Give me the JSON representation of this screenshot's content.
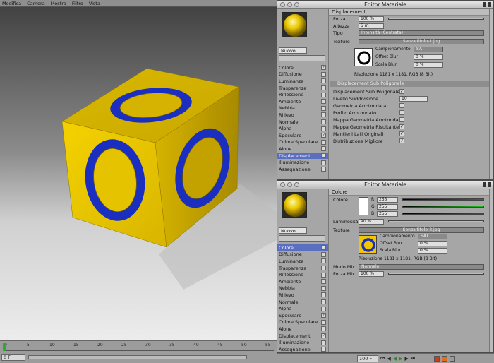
{
  "viewport": {
    "menu": [
      "Modifica",
      "Camera",
      "Mostra",
      "Filtro",
      "Vista"
    ]
  },
  "timeline": {
    "ticks": [
      "0",
      "5",
      "10",
      "15",
      "20",
      "25",
      "30",
      "35",
      "40",
      "45",
      "50",
      "55"
    ],
    "start_field": "0 F",
    "end_field": "100 F"
  },
  "editor1": {
    "title": "Editor Materiale",
    "name": "Nuovo",
    "channels": [
      {
        "label": "Colore",
        "checked": true
      },
      {
        "label": "Diffusione",
        "checked": false
      },
      {
        "label": "Luminanza",
        "checked": false
      },
      {
        "label": "Trasparenza",
        "checked": false
      },
      {
        "label": "Riflessione",
        "checked": false
      },
      {
        "label": "Ambiente",
        "checked": false
      },
      {
        "label": "Nebbia",
        "checked": false
      },
      {
        "label": "Rilievo",
        "checked": false
      },
      {
        "label": "Normale",
        "checked": false
      },
      {
        "label": "Alpha",
        "checked": false
      },
      {
        "label": "Speculare",
        "checked": true
      },
      {
        "label": "Colore Speculare",
        "checked": false
      },
      {
        "label": "Alone",
        "checked": false
      },
      {
        "label": "Displacement",
        "checked": true
      },
      {
        "label": "Illuminazione",
        "checked": false
      },
      {
        "label": "Assegnazione",
        "checked": false
      }
    ],
    "section": "Displacement",
    "forza_label": "Forza",
    "forza_value": "100 %",
    "altezza_label": "Altezza",
    "altezza_value": "5 m",
    "tipo_label": "Tipo",
    "tipo_value": "Intensità (Centrata)",
    "texture_label": "Texture",
    "texture_name": "Senza titolo-1.jpg",
    "campionamento_label": "Campionamento",
    "campionamento_value": "SAT",
    "offset_label": "Offset Blur",
    "offset_value": "0 %",
    "scala_label": "Scala Blur",
    "scala_value": "0 %",
    "risoluzione": "Risoluzione 1181 x 1181, RGB (8 Bit)",
    "subpoly_header": "Displacement Sub Poligonale",
    "subpoly_rows": [
      {
        "label": "Displacement Sub Poligonale",
        "type": "check",
        "checked": true
      },
      {
        "label": "Livello Suddivisione",
        "type": "value",
        "value": "10"
      },
      {
        "label": "Geometria Arrotondata",
        "type": "check",
        "checked": false
      },
      {
        "label": "Profilo Arrotondato",
        "type": "check",
        "checked": false
      },
      {
        "label": "Mappa Geometria Arrotondata",
        "type": "check",
        "checked": false
      },
      {
        "label": "Mappa Geometria Risultante",
        "type": "check",
        "checked": true
      },
      {
        "label": "Mantieni Lati Originali",
        "type": "check",
        "checked": true
      },
      {
        "label": "Distribuzione Migliore",
        "type": "check",
        "checked": true
      }
    ]
  },
  "editor2": {
    "title": "Editor Materiale",
    "name": "Nuovo",
    "channels": [
      {
        "label": "Colore",
        "checked": true
      },
      {
        "label": "Diffusione",
        "checked": false
      },
      {
        "label": "Luminanza",
        "checked": false
      },
      {
        "label": "Trasparenza",
        "checked": false
      },
      {
        "label": "Riflessione",
        "checked": false
      },
      {
        "label": "Ambiente",
        "checked": false
      },
      {
        "label": "Nebbia",
        "checked": false
      },
      {
        "label": "Rilievo",
        "checked": false
      },
      {
        "label": "Normale",
        "checked": false
      },
      {
        "label": "Alpha",
        "checked": false
      },
      {
        "label": "Speculare",
        "checked": true
      },
      {
        "label": "Colore Speculare",
        "checked": false
      },
      {
        "label": "Alone",
        "checked": false
      },
      {
        "label": "Displacement",
        "checked": true
      },
      {
        "label": "Illuminazione",
        "checked": false
      },
      {
        "label": "Assegnazione",
        "checked": false
      }
    ],
    "section": "Colore",
    "colore_label": "Colore",
    "r_label": "R",
    "r_value": "255",
    "g_label": "G",
    "g_value": "255",
    "b_label": "B",
    "b_value": "255",
    "luminosita_label": "Luminosità",
    "luminosita_value": "90 %",
    "texture_label": "Texture",
    "texture_name": "Senza titolo-2.jpg",
    "campionamento_label": "Campionamento",
    "campionamento_value": "SAT",
    "offset_label": "Offset Blur",
    "offset_value": "0 %",
    "scala_label": "Scala Blur",
    "scala_value": "0 %",
    "risoluzione": "Risoluzione 1181 x 1181, RGB (8 Bit)",
    "modo_label": "Modo Mix",
    "modo_value": "Normale",
    "forza_mix_label": "Forza Mix",
    "forza_mix_value": "100 %"
  },
  "colors": {
    "cube_yellow": "#e8c400",
    "ring_blue": "#1a2fc0",
    "active_channel": "#5a6fc0"
  }
}
